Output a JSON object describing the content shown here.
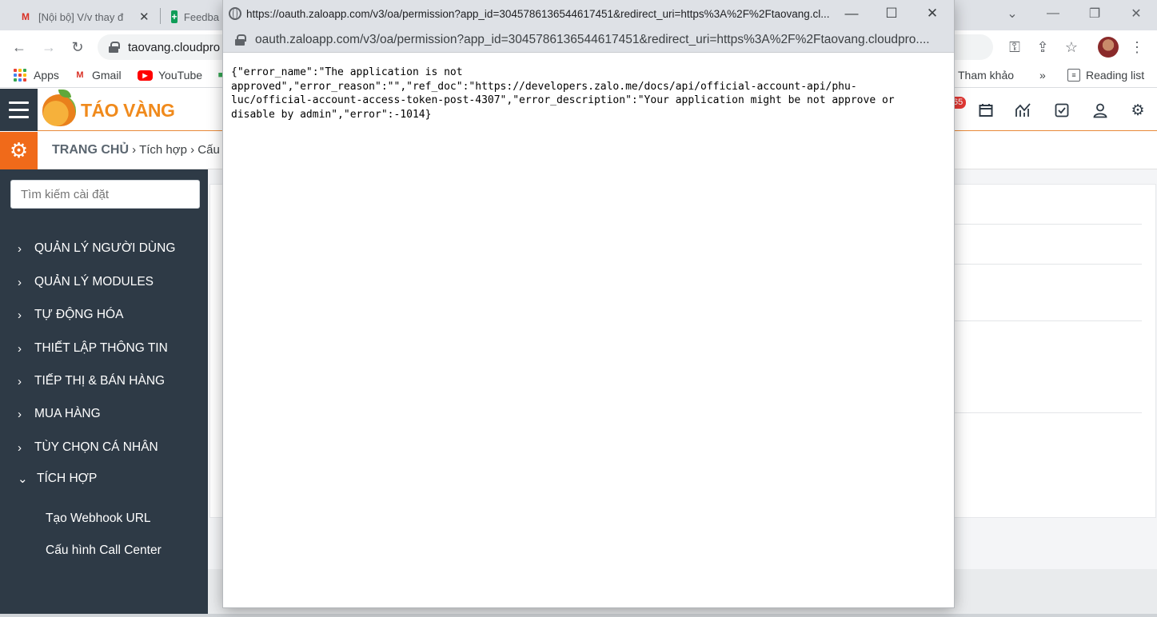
{
  "browser": {
    "tabs": [
      {
        "icon": "gmail-icon",
        "title": "[Nội bộ] V/v thay đ"
      },
      {
        "icon": "sheets-icon",
        "title": "Feedba"
      }
    ],
    "address": "taovang.cloudpro",
    "bookmarks": {
      "apps": "Apps",
      "gmail": "Gmail",
      "youtube": "YouTube",
      "tham_khao": "Tham khảo",
      "more": "»",
      "reading_list": "Reading list"
    }
  },
  "app": {
    "logo_text": "TÁO VÀNG",
    "notification_count": "65",
    "breadcrumb": {
      "home": "TRANG CHỦ",
      "sep1": "›",
      "item1": "Tích hợp",
      "sep2": "›",
      "item2": "Cấu"
    },
    "search_placeholder": "Tìm kiếm cài đặt",
    "sidebar": [
      {
        "label": "QUẢN LÝ NGƯỜI DÙNG",
        "chevron": "›"
      },
      {
        "label": "QUẢN LÝ MODULES",
        "chevron": "›"
      },
      {
        "label": "TỰ ĐỘNG HÓA",
        "chevron": "›"
      },
      {
        "label": "THIẾT LẬP THÔNG TIN",
        "chevron": "›"
      },
      {
        "label": "TIẾP THỊ & BÁN HÀNG",
        "chevron": "›"
      },
      {
        "label": "MUA HÀNG",
        "chevron": "›"
      },
      {
        "label": "TÙY CHỌN CÁ NHÂN",
        "chevron": "›"
      },
      {
        "label": "TÍCH HỢP",
        "chevron": "⌄"
      }
    ],
    "sidebar_sub": [
      "Tạo Webhook URL",
      "Cấu hình Call Center"
    ]
  },
  "popup": {
    "title": "https://oauth.zaloapp.com/v3/oa/permission?app_id=3045786136544617451&redirect_uri=https%3A%2F%2Ftaovang.cl...",
    "url": "oauth.zaloapp.com/v3/oa/permission?app_id=3045786136544617451&redirect_uri=https%3A%2F%2Ftaovang.cloudpro....",
    "body": "{\"error_name\":\"The application is not\napproved\",\"error_reason\":\"\",\"ref_doc\":\"https://developers.zalo.me/docs/api/official-account-api/phu-\nluc/official-account-access-token-post-4307\",\"error_description\":\"Your application might be not approve or\ndisable by admin\",\"error\":-1014}"
  }
}
